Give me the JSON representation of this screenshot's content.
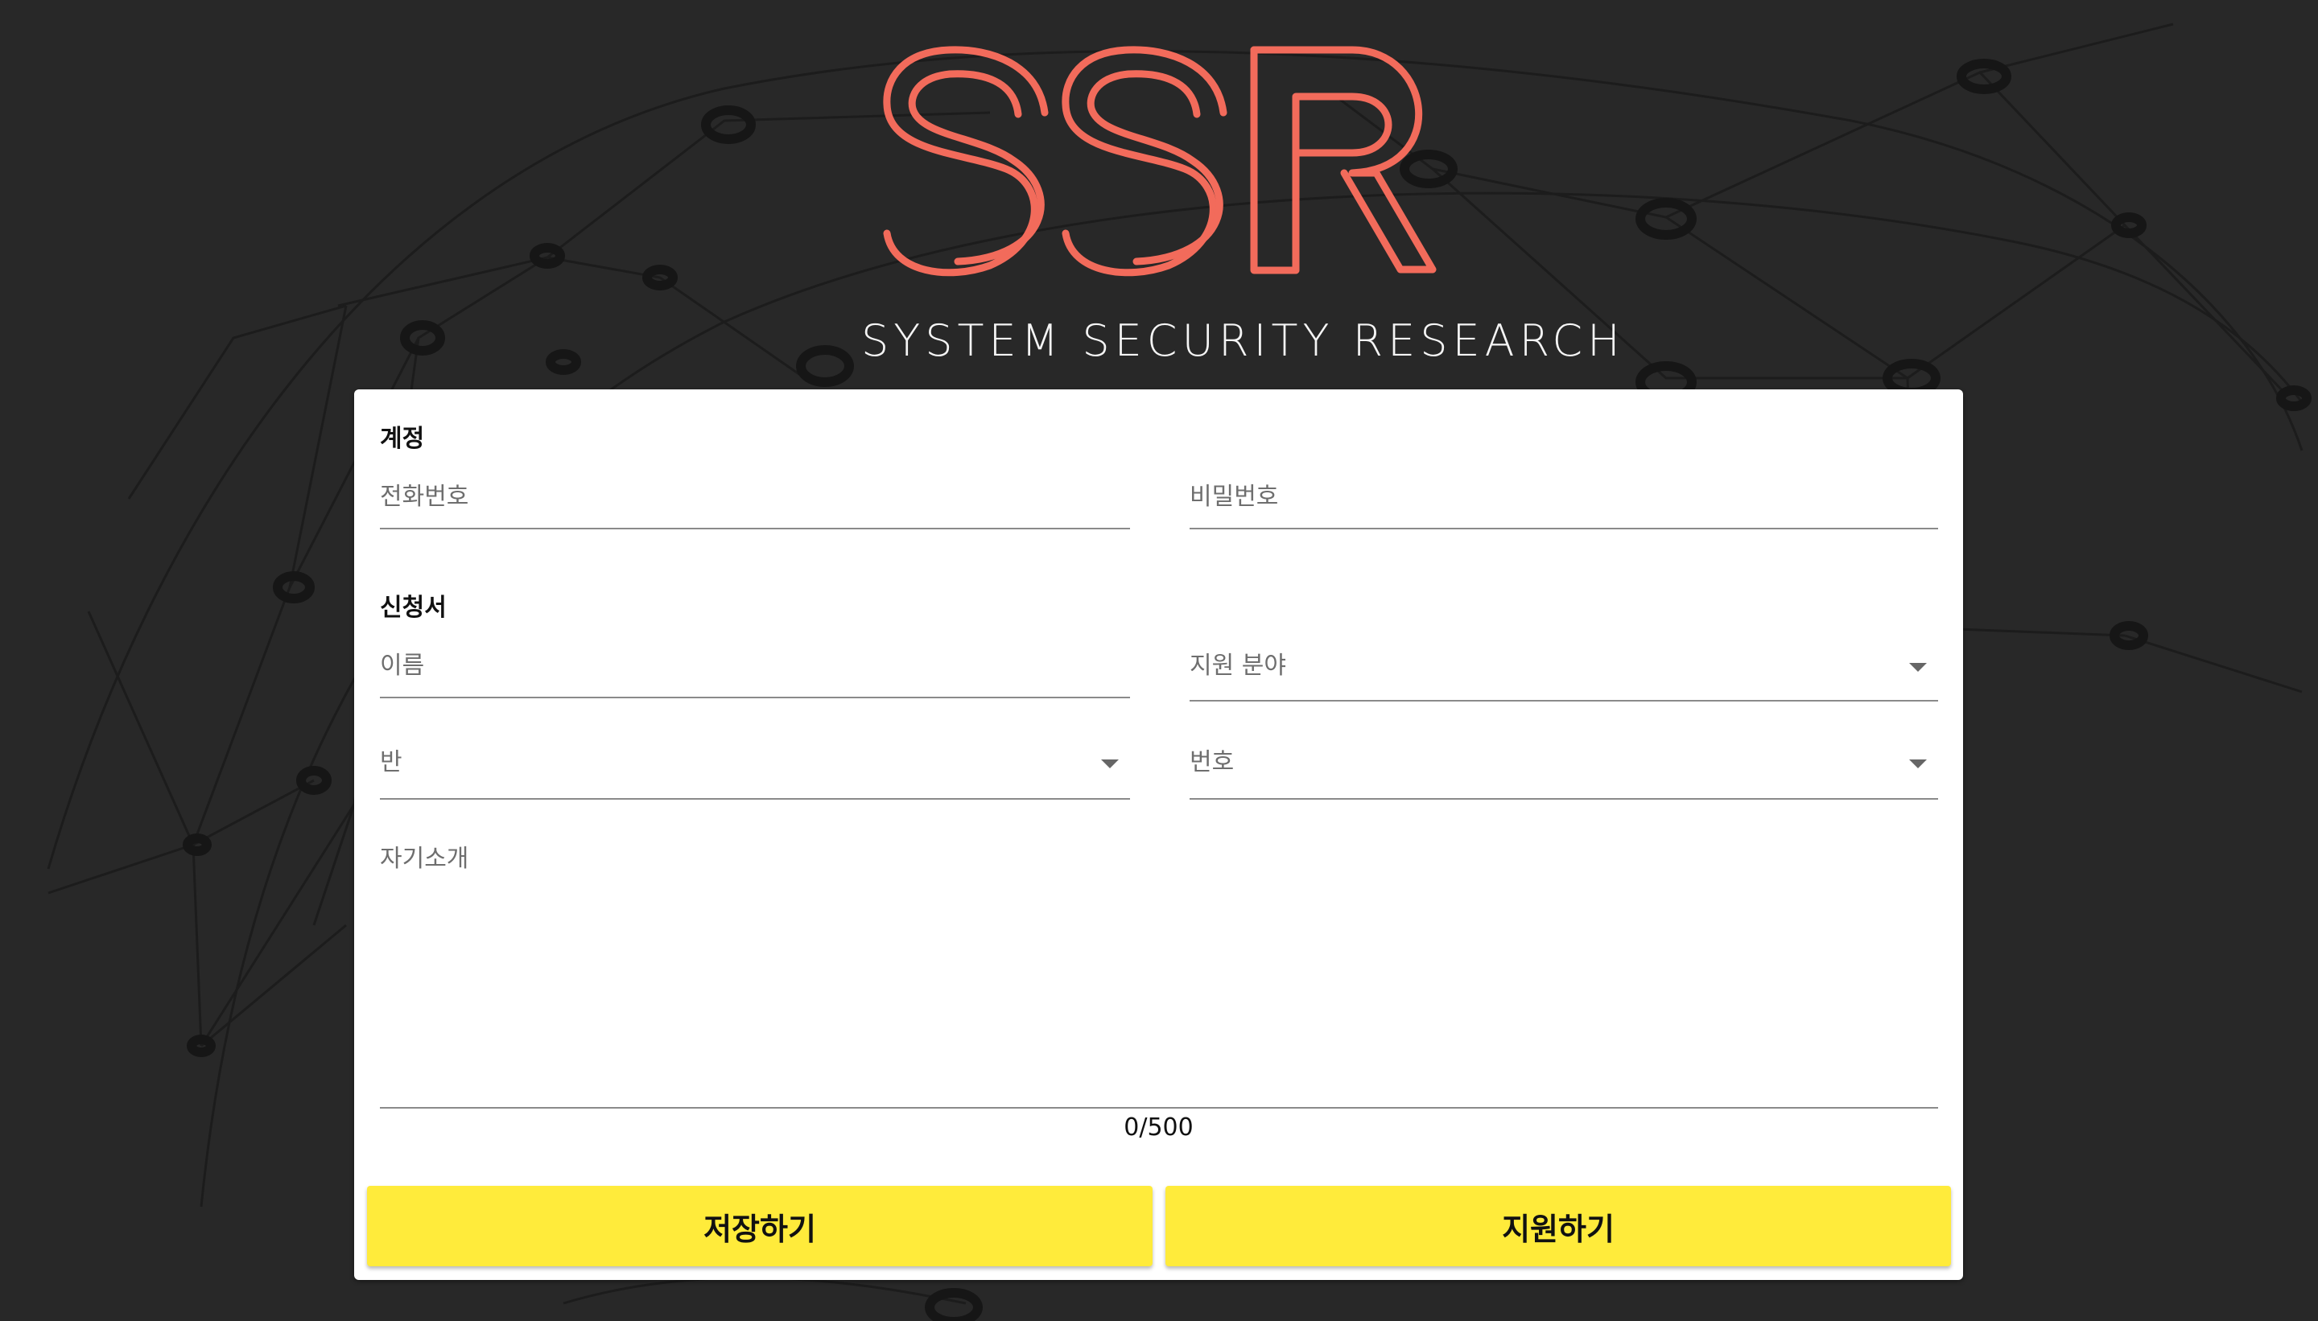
{
  "brand": {
    "logo_text": "SSR",
    "subtitle": "SYSTEM SECURITY RESEARCH",
    "logo_color": "#f26b5b"
  },
  "form": {
    "account_section": "계정",
    "phone_label": "전화번호",
    "password_label": "비밀번호",
    "application_section": "신청서",
    "name_label": "이름",
    "field_label": "지원 분야",
    "class_label": "반",
    "number_label": "번호",
    "intro_label": "자기소개",
    "intro_counter": "0/500"
  },
  "buttons": {
    "save_label": "저장하기",
    "apply_label": "지원하기",
    "color": "#ffeb3b"
  }
}
